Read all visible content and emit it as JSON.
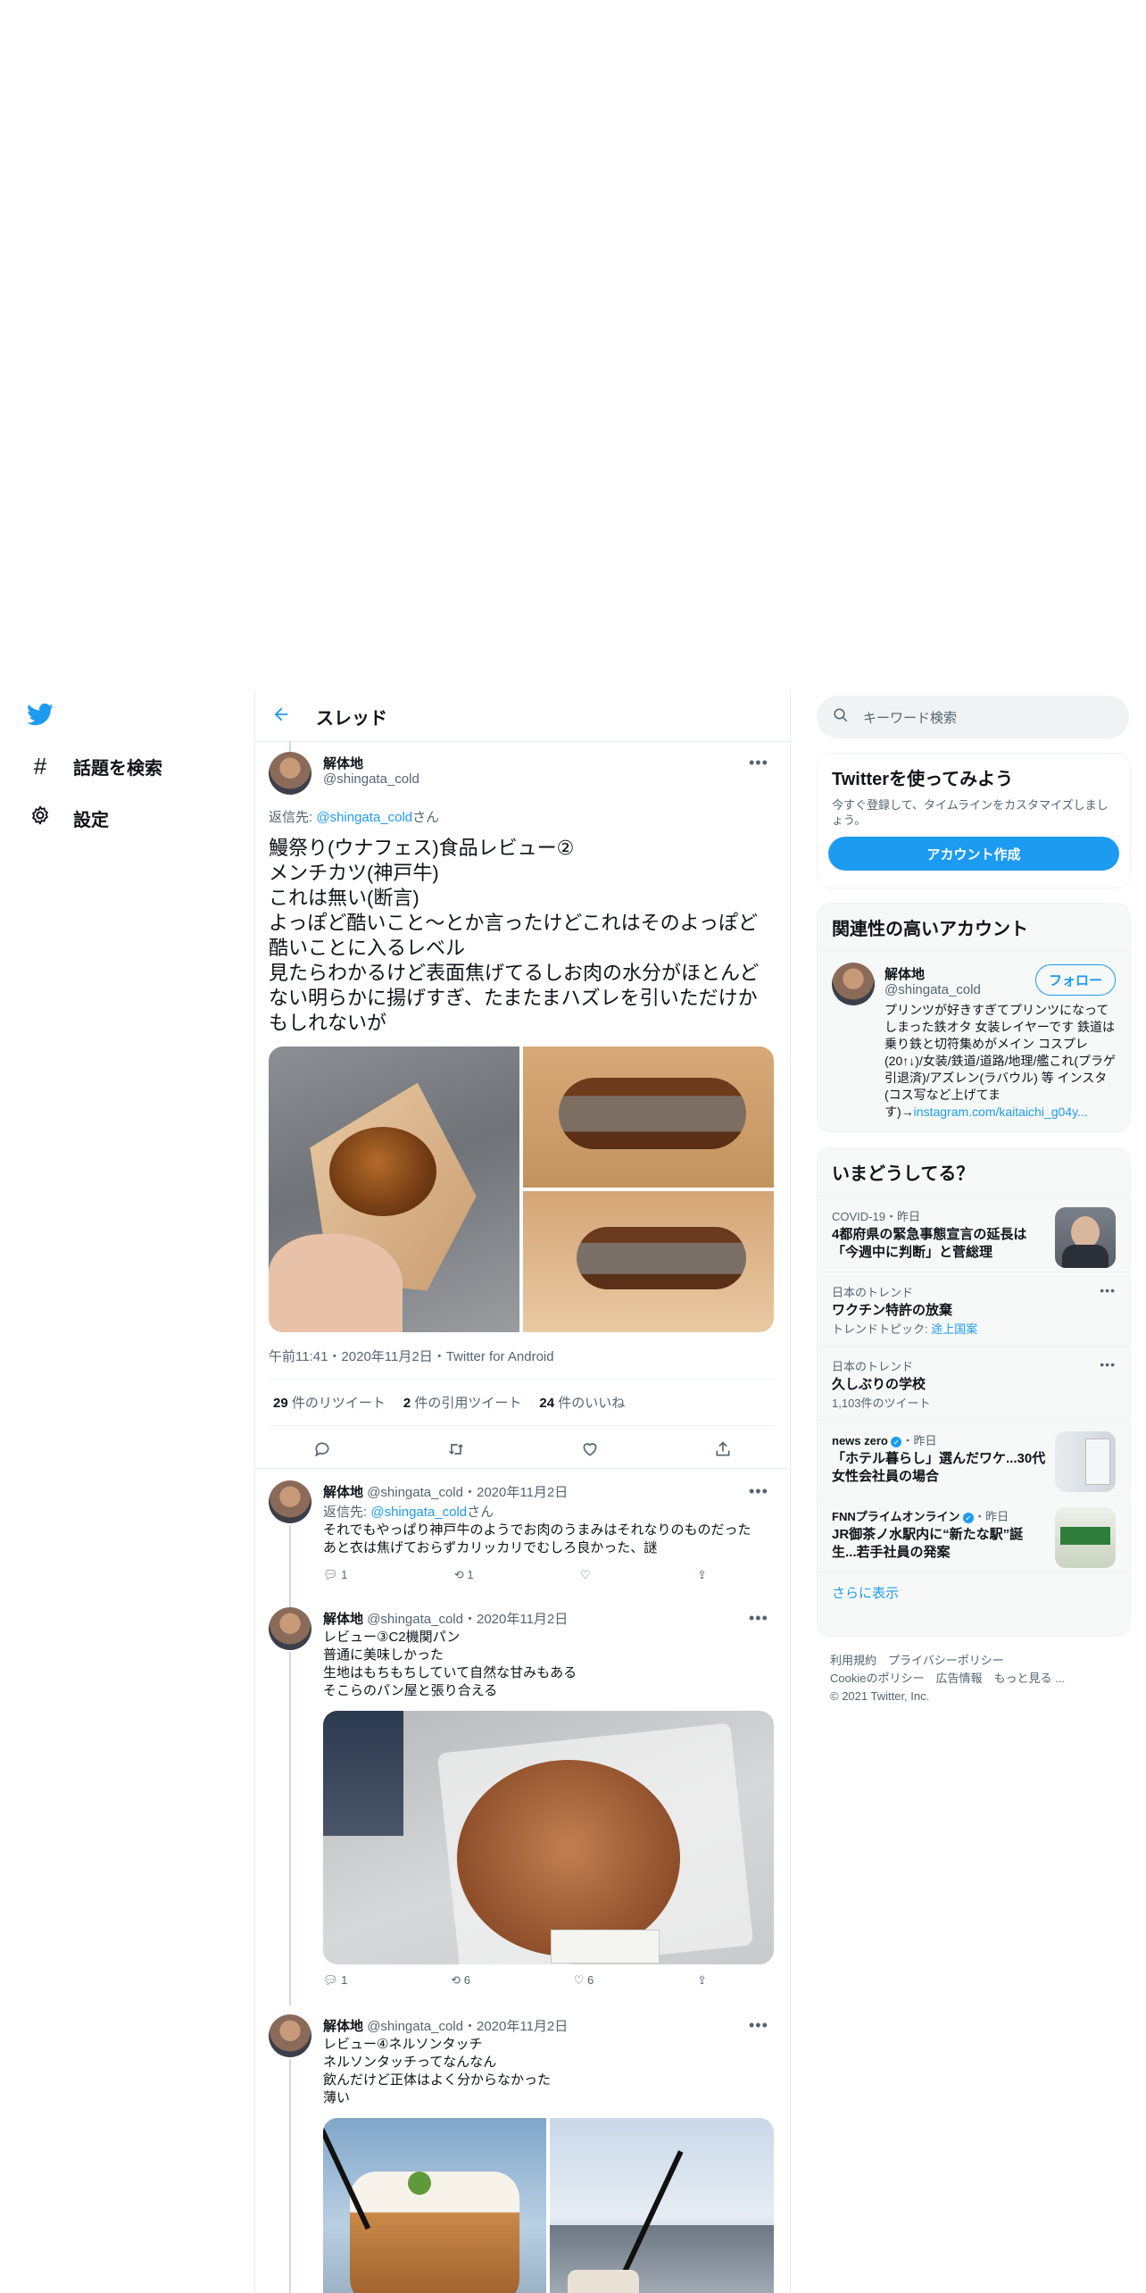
{
  "nav": {
    "explore_label": "話題を検索",
    "settings_label": "設定"
  },
  "header": {
    "title": "スレッド"
  },
  "main_tweet": {
    "author": "解体地",
    "handle": "@shingata_cold",
    "reply_prefix": "返信先: ",
    "reply_to": "@shingata_cold",
    "reply_suffix": "さん",
    "text_lines": [
      "鰻祭り(ウナフェス)食品レビュー②",
      "メンチカツ(神戸牛)",
      "これは無い(断言)",
      "よっぽど酷いこと〜とか言ったけどこれはそのよっぽど酷いことに入るレベル",
      "見たらわかるけど表面焦げてるしお肉の水分がほとんどない明らかに揚げすぎ、たまたまハズレを引いただけかもしれないが"
    ],
    "meta": "午前11:41・2020年11月2日・Twitter for Android",
    "retweets_count": "29",
    "retweets_label": "件のリツイート",
    "quotes_count": "2",
    "quotes_label": "件の引用ツイート",
    "likes_count": "24",
    "likes_label": "件のいいね"
  },
  "replies": [
    {
      "author": "解体地",
      "handle_date": "@shingata_cold・2020年11月2日",
      "reply_prefix": "返信先: ",
      "reply_to": "@shingata_cold",
      "reply_suffix": "さん",
      "text_lines": [
        "それでもやっぱり神戸牛のようでお肉のうまみはそれなりのものだった",
        "あと衣は焦げておらずカリッカリでむしろ良かった、謎"
      ],
      "reply_count": "1",
      "retweet_count": "1",
      "like_count": ""
    },
    {
      "author": "解体地",
      "handle_date": "@shingata_cold・2020年11月2日",
      "text_lines": [
        "レビュー③C2機関パン",
        "普通に美味しかった",
        "生地はもちもちしていて自然な甘みもある",
        "そこらのパン屋と張り合える"
      ],
      "reply_count": "1",
      "retweet_count": "6",
      "like_count": "6"
    },
    {
      "author": "解体地",
      "handle_date": "@shingata_cold・2020年11月2日",
      "text_lines": [
        "レビュー④ネルソンタッチ",
        "ネルソンタッチってなんなん",
        "飲んだけど正体はよく分からなかった",
        "薄い"
      ]
    }
  ],
  "search": {
    "placeholder": "キーワード検索"
  },
  "signup": {
    "title": "Twitterを使ってみよう",
    "desc": "今すぐ登録して、タイムラインをカスタマイズしましょう。",
    "button": "アカウント作成"
  },
  "relevant": {
    "title": "関連性の高いアカウント",
    "name": "解体地",
    "handle": "@shingata_cold",
    "follow": "フォロー",
    "bio": "プリンツが好きすぎてプリンツになってしまった鉄オタ 女装レイヤーです 鉄道は乗り鉄と切符集めがメイン コスプレ(20↑↓)/女装/鉄道/道路/地理/艦これ(プラゲ引退済)/アズレン(ラバウル) 等 インスタ(コス写など上げてます)→",
    "bio_link": "instagram.com/kaitaichi_g04y..."
  },
  "trends": {
    "title": "いまどうしてる？",
    "items": [
      {
        "category": "COVID-19・昨日",
        "title": "4都府県の緊急事態宣言の延長は「今週中に判断」と菅総理",
        "sub": ""
      },
      {
        "category": "日本のトレンド",
        "title": "ワクチン特許の放棄",
        "sub_prefix": "トレンドトピック: ",
        "sub_link": "途上国案"
      },
      {
        "category": "日本のトレンド",
        "title": "久しぶりの学校",
        "sub": "1,103件のツイート"
      },
      {
        "category_name": "news zero",
        "category": "・昨日",
        "title": "「ホテル暮らし」選んだワケ...30代女性会社員の場合"
      },
      {
        "category_name": "FNNプライムオンライン",
        "category": "・昨日",
        "title": "JR御茶ノ水駅内に“新たな駅”誕生...若手社員の発案"
      }
    ],
    "show_more": "さらに表示"
  },
  "footer": {
    "line1": "利用規約　プライバシーポリシー",
    "line2": "Cookieのポリシー　広告情報　もっと見る ...",
    "line3": "© 2021 Twitter, Inc."
  },
  "colors": {
    "accent": "#1d9bf0",
    "text": "#0f1419",
    "muted": "#536471",
    "border": "#e6ecf0"
  },
  "icons": [
    "twitter-logo-icon",
    "hashtag-icon",
    "gear-icon",
    "back-arrow-icon",
    "more-icon",
    "reply-icon",
    "retweet-icon",
    "like-icon",
    "share-icon",
    "search-icon",
    "verified-icon"
  ]
}
